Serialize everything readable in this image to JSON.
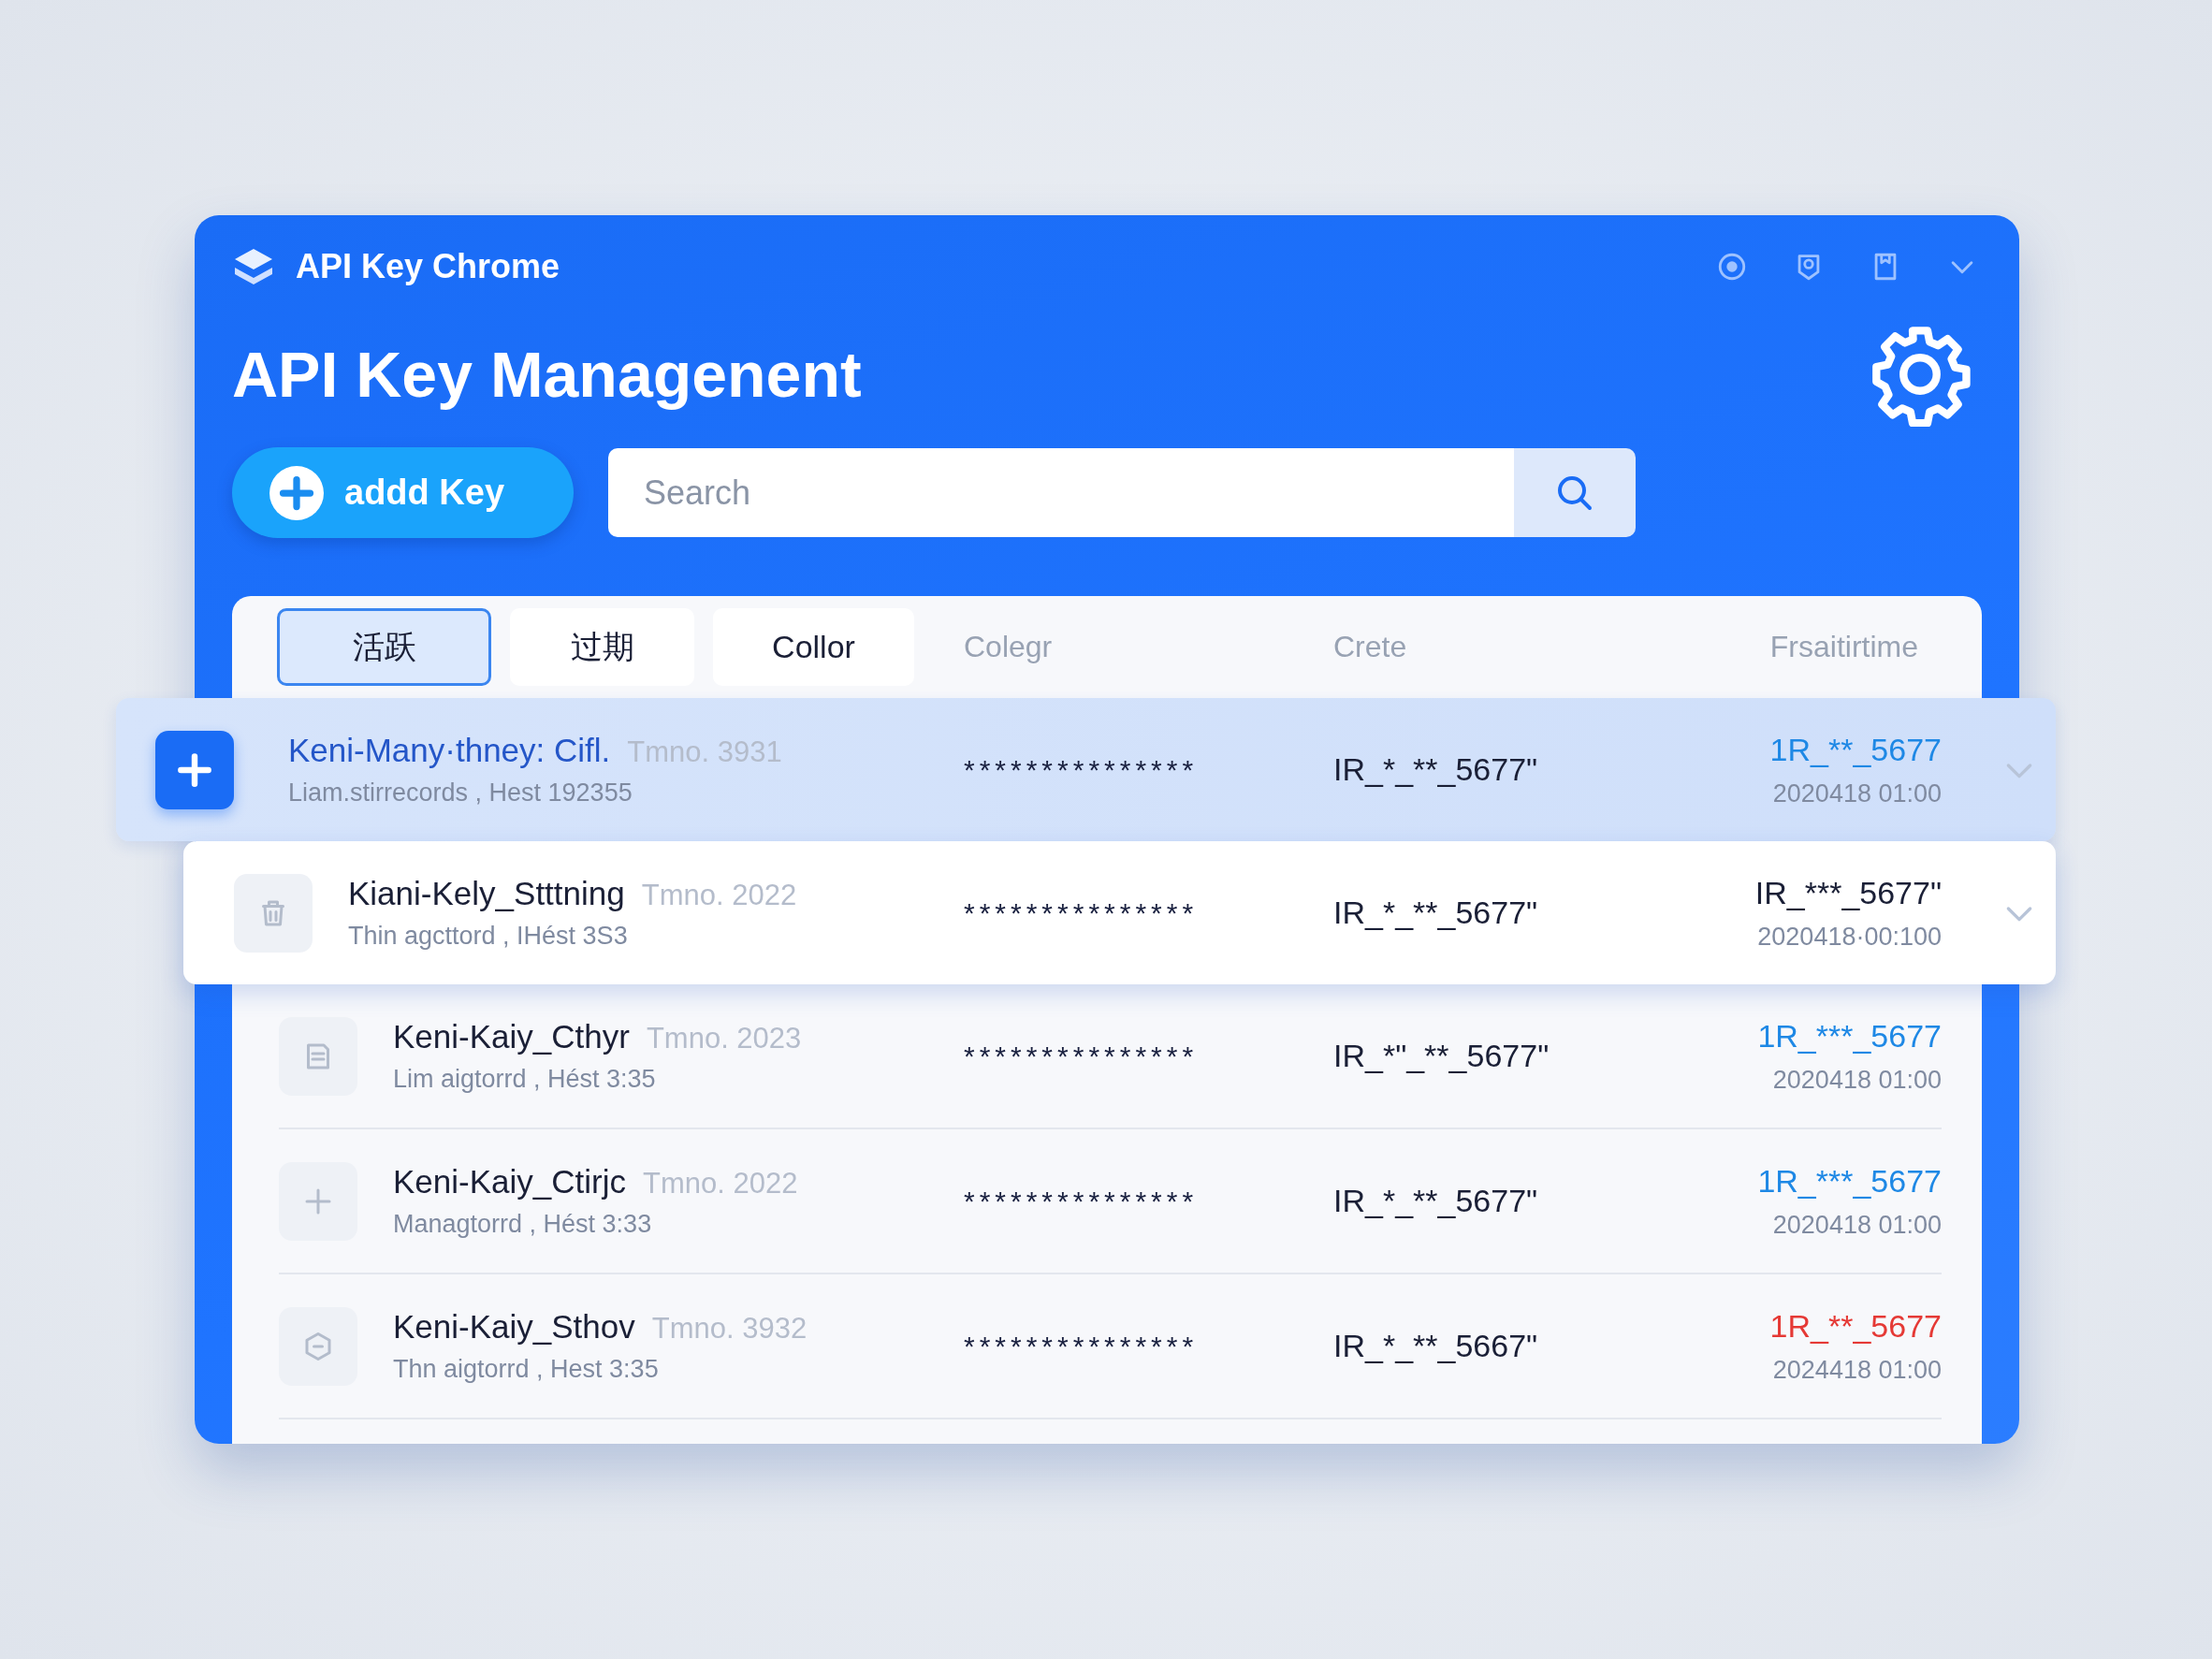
{
  "window": {
    "title": "API Key Chrome"
  },
  "heading": "API Key Managenent",
  "add_button": {
    "label": "addd Key"
  },
  "search": {
    "placeholder": "Search"
  },
  "tabs": [
    {
      "label": "活跃",
      "selected": true
    },
    {
      "label": "过期",
      "selected": false
    },
    {
      "label": "Collor",
      "selected": false
    }
  ],
  "columns": [
    "Colegr",
    "Crete",
    "Frsaitirtime"
  ],
  "rows": [
    {
      "kind": "plus",
      "name": "Keni-Many·thney: Cifl.",
      "tag": "Tmno. 3931",
      "subtitle": "Liam.stirrecords , Hest 192355",
      "masked": "***************",
      "key": "IR_*_**_5677\"",
      "value": "1R_**_5677",
      "color": "#1e88e5",
      "date": "2020418 01:00",
      "selected": true,
      "raised": false,
      "expandable": true
    },
    {
      "kind": "trash",
      "name": "Kiani-Kely_Stttning",
      "tag": "Tmno. 2022",
      "subtitle": "Thin agcttord , IHést 3S3",
      "masked": "***************",
      "key": "IR_*_**_5677\"",
      "value": "IR_***_5677\"",
      "color": "#1a1f36",
      "date": "2020418·00:100",
      "selected": false,
      "raised": true,
      "expandable": true
    },
    {
      "kind": "document",
      "name": "Keni-Kaiy_Cthyr",
      "tag": "Tmno. 2023",
      "subtitle": "Lim aigtorrd , Hést 3:35",
      "masked": "***************",
      "key": "IR_*\"_**_5677\"",
      "value": "1R_***_5677",
      "color": "#1e88e5",
      "date": "2020418 01:00",
      "selected": false,
      "raised": false,
      "expandable": false
    },
    {
      "kind": "plus",
      "name": "Keni-Kaiy_Ctirjc",
      "tag": "Tmno. 2022",
      "subtitle": "Managtorrd , Hést 3:33",
      "masked": "***************",
      "key": "IR_*_**_5677\"",
      "value": "1R_***_5677",
      "color": "#1e88e5",
      "date": "2020418 01:00",
      "selected": false,
      "raised": false,
      "expandable": false
    },
    {
      "kind": "shield",
      "name": "Keni-Kaiy_Sthov",
      "tag": "Tmno. 3932",
      "subtitle": "Thn aigtorrd , Hest 3:35",
      "masked": "***************",
      "key": "IR_*_**_5667\"",
      "value": "1R_**_5677",
      "color": "#e53935",
      "date": "2024418 01:00",
      "selected": false,
      "raised": false,
      "expandable": false
    }
  ]
}
